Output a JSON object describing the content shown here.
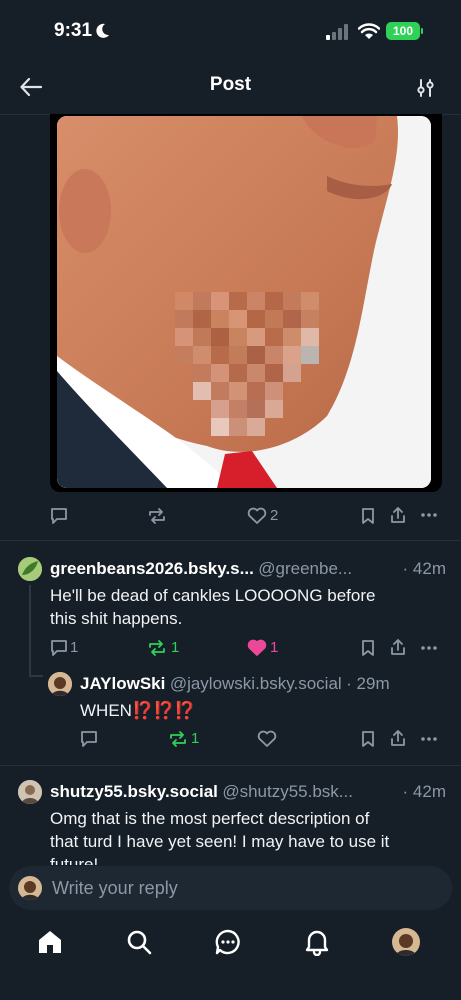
{
  "status_bar": {
    "time": "9:31",
    "battery": "100"
  },
  "header": {
    "title": "Post"
  },
  "main_post": {
    "likes": "2"
  },
  "replies": [
    {
      "author": "greenbeans2026.bsky.s...",
      "handle": "@greenbe...",
      "time": "· 42m",
      "text_line1": "He'll be dead of cankles LOOOONG before",
      "text_line2": "this shit happens.",
      "replies": "1",
      "reposts": "1",
      "likes": "1"
    },
    {
      "author": "JAYlowSki",
      "handle": "@jaylowski.bsky.social",
      "time": "· 29m",
      "text": "WHEN⁉️⁉️⁉️",
      "reposts": "1"
    },
    {
      "author": "shutzy55.bsky.social",
      "handle": "@shutzy55.bsk...",
      "time": "· 42m",
      "text_line1": "Omg that is the most perfect description of",
      "text_line2": "that turd I have yet seen! I may have to use it",
      "text_line3": "future!"
    }
  ],
  "composer": {
    "placeholder": "Write your reply"
  },
  "colors": {
    "background": "#161e27",
    "like_pink": "#ec4899",
    "repost_green": "#2fd158",
    "muted": "#8b98a5"
  }
}
